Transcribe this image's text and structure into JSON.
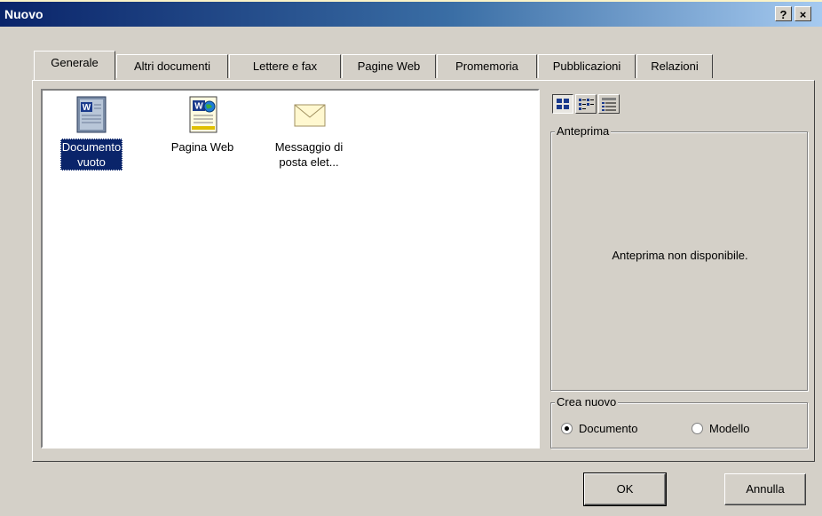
{
  "window": {
    "title": "Nuovo",
    "help_glyph": "?",
    "close_glyph": "×"
  },
  "tabs": [
    {
      "label": "Generale",
      "active": true
    },
    {
      "label": "Altri documenti"
    },
    {
      "label": "Lettere e fax"
    },
    {
      "label": "Pagine Web"
    },
    {
      "label": "Promemoria"
    },
    {
      "label": "Pubblicazioni"
    },
    {
      "label": "Relazioni"
    }
  ],
  "templates": [
    {
      "label_line1": "Documento",
      "label_line2": "vuoto",
      "icon": "word-document-icon",
      "selected": true
    },
    {
      "label_line1": "Pagina Web",
      "label_line2": "",
      "icon": "word-web-page-icon"
    },
    {
      "label_line1": "Messaggio di",
      "label_line2": "posta elet...",
      "icon": "envelope-icon"
    }
  ],
  "view_buttons": [
    {
      "icon": "large-icons-view-icon",
      "pressed": true
    },
    {
      "icon": "list-view-icon"
    },
    {
      "icon": "details-view-icon"
    }
  ],
  "preview": {
    "group_title": "Anteprima",
    "message": "Anteprima non disponibile."
  },
  "create_new": {
    "group_title": "Crea nuovo",
    "options": [
      {
        "label": "Documento",
        "checked": true
      },
      {
        "label": "Modello",
        "checked": false
      }
    ]
  },
  "buttons": {
    "ok": "OK",
    "cancel": "Annulla"
  },
  "colors": {
    "titlebar_start": "#0a246a",
    "titlebar_end": "#a6caf0",
    "face": "#d4d0c8",
    "selection": "#0a246a",
    "outer_background": "#fbf3c7"
  }
}
